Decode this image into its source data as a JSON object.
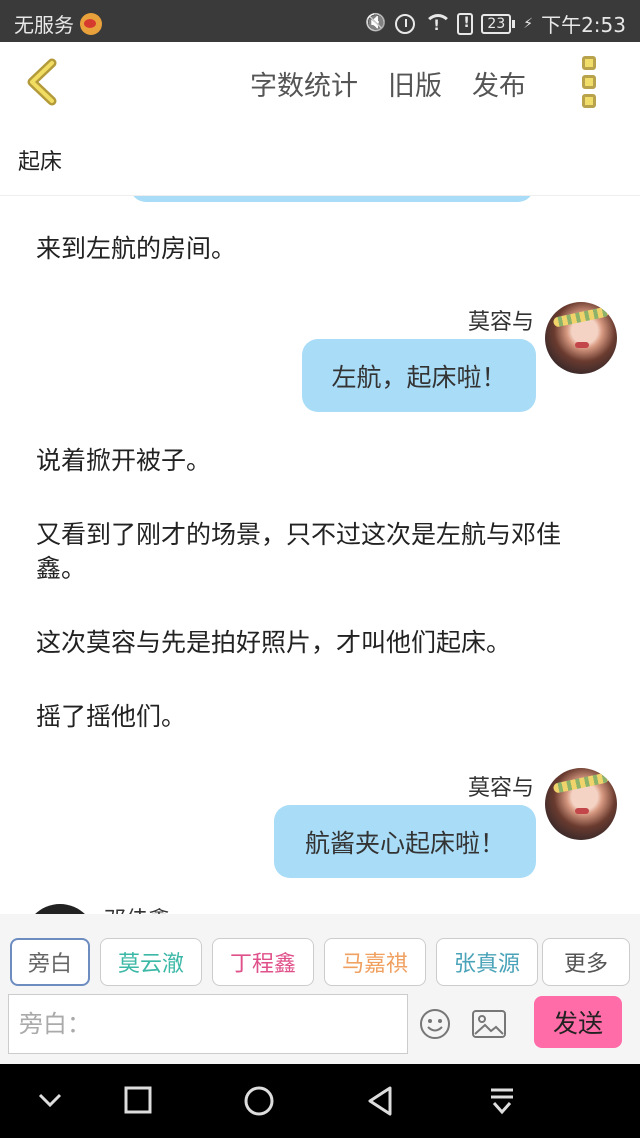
{
  "status_bar": {
    "carrier": "无服务",
    "battery": "23",
    "time": "下午2:53",
    "icons": [
      "weibo-icon",
      "mute-icon",
      "alarm-icon",
      "wifi-icon",
      "sim-alert-icon",
      "battery-icon",
      "charging-icon"
    ]
  },
  "header": {
    "actions": [
      "字数统计",
      "旧版",
      "发布"
    ],
    "icons": [
      "back-chevron-icon",
      "more-menu-icon"
    ]
  },
  "title": "起床",
  "story": {
    "narration": [
      "来到左航的房间。",
      "说着掀开被子。",
      "又看到了刚才的场景，只不过这次是左航与邓佳鑫。",
      "这次莫容与先是拍好照片，才叫他们起床。",
      "摇了摇他们。"
    ],
    "messages": [
      {
        "speaker": "莫容与",
        "text": "左航，起床啦！"
      },
      {
        "speaker": "莫容与",
        "text": "航酱夹心起床啦！"
      }
    ],
    "partial_speaker": "邓佳鑫"
  },
  "roles": [
    {
      "label": "旁白",
      "color": "#777777"
    },
    {
      "label": "莫云澈",
      "color": "#3cb8a6"
    },
    {
      "label": "丁程鑫",
      "color": "#e0508a"
    },
    {
      "label": "马嘉祺",
      "color": "#f0a060"
    },
    {
      "label": "张真源",
      "color": "#4aa3b8"
    },
    {
      "label": "更多",
      "color": "#555555"
    }
  ],
  "composer": {
    "placeholder": "旁白：",
    "send_label": "发送",
    "icons": [
      "emoji-icon",
      "image-icon"
    ]
  },
  "nav_bar": {
    "icons": [
      "collapse-icon",
      "recents-icon",
      "home-icon",
      "back-icon",
      "notification-pull-icon"
    ]
  }
}
